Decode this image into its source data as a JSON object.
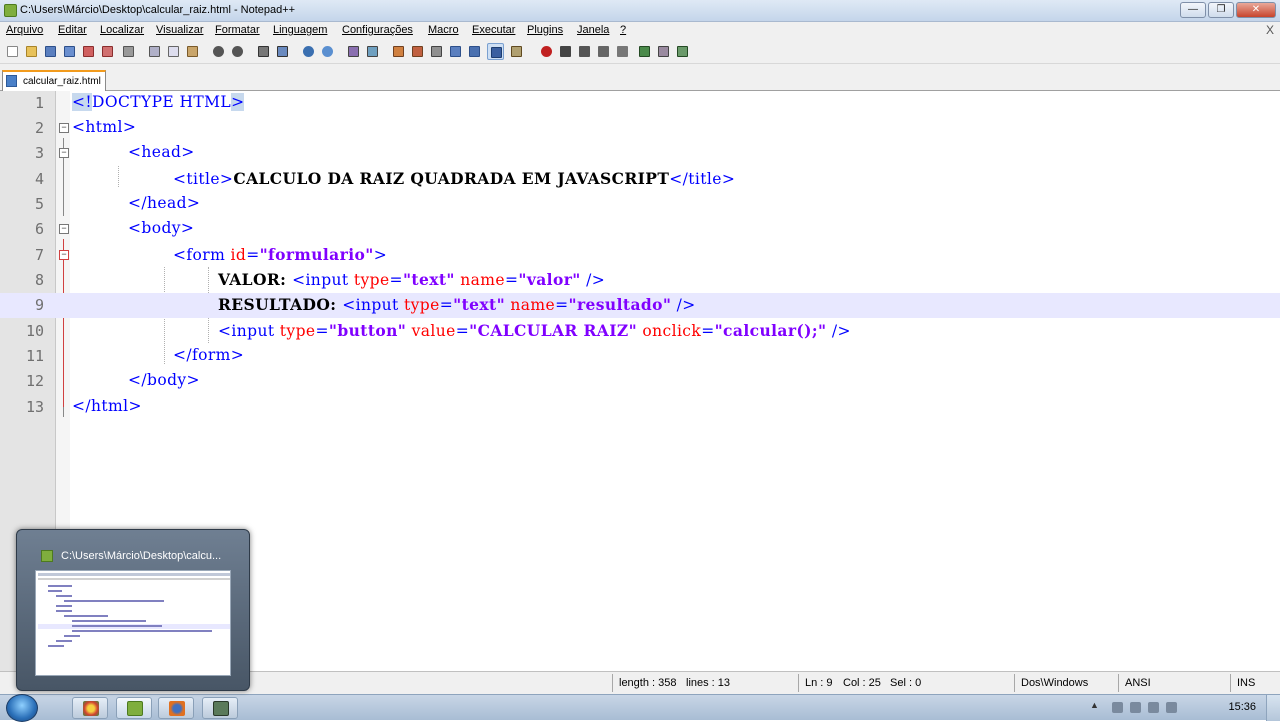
{
  "window": {
    "title": "C:\\Users\\Márcio\\Desktop\\calcular_raiz.html - Notepad++",
    "minimize": "—",
    "maximize": "❐",
    "close": "✕"
  },
  "menu": [
    "Arquivo",
    "Editar",
    "Localizar",
    "Visualizar",
    "Formatar",
    "Linguagem",
    "Configurações",
    "Macro",
    "Executar",
    "Plugins",
    "Janela",
    "?"
  ],
  "menu_close": "X",
  "tab": {
    "label": "calcular_raiz.html"
  },
  "code": {
    "line_numbers": [
      "1",
      "2",
      "3",
      "4",
      "5",
      "6",
      "7",
      "8",
      "9",
      "10",
      "11",
      "12",
      "13"
    ],
    "current_line": 9
  },
  "status": {
    "length": "length : 358",
    "lines": "lines : 13",
    "ln": "Ln : 9",
    "col": "Col : 25",
    "sel": "Sel : 0",
    "eol": "Dos\\Windows",
    "encoding": "ANSI",
    "mode": "INS"
  },
  "taskbar": {
    "preview_title": "C:\\Users\\Márcio\\Desktop\\calcu...",
    "clock": "15:36"
  },
  "colors": {
    "tag": "#0000ff",
    "attr": "#ff0000",
    "value": "#8000ff",
    "current_line": "#e8e8ff"
  }
}
